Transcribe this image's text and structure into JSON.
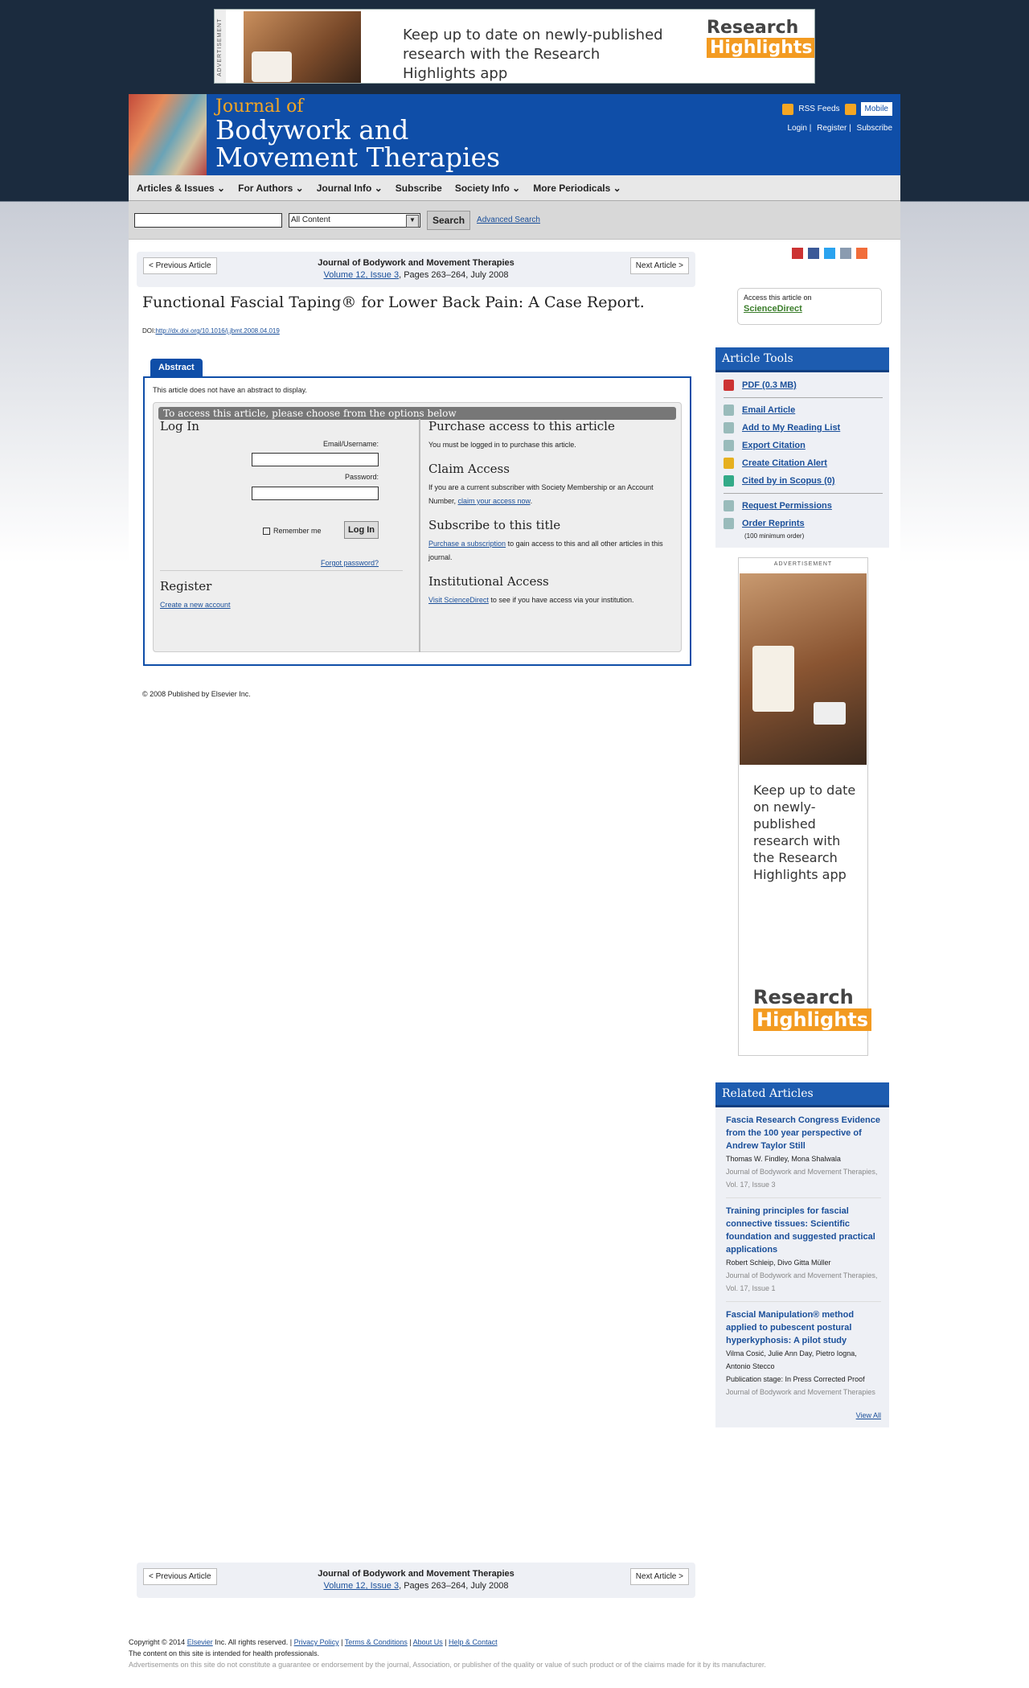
{
  "ad_top": {
    "label": "ADVERTISEMENT",
    "text": "Keep up to date on newly-published research with the Research Highlights app",
    "logo_top": "Research",
    "logo_bottom": "Highlights"
  },
  "header": {
    "journal_of": "Journal of",
    "journal_name_1": "Bodywork and",
    "journal_name_2": "Movement Therapies",
    "rss": "RSS Feeds",
    "mobile": "Mobile",
    "login": "Login",
    "register": "Register",
    "subscribe": "Subscribe"
  },
  "nav": [
    "Articles & Issues ⌄",
    "For Authors ⌄",
    "Journal Info ⌄",
    "Subscribe",
    "Society Info ⌄",
    "More Periodicals ⌄"
  ],
  "search": {
    "select": "All Content",
    "button": "Search",
    "advanced": "Advanced Search"
  },
  "artnav": {
    "prev": "< Previous Article",
    "next": "Next Article >",
    "journal": "Journal of Bodywork and Movement Therapies",
    "volume": "Volume 12, Issue 3",
    "pages": ", Pages 263–264, July 2008"
  },
  "article": {
    "title": "Functional Fascial Taping® for Lower Back Pain: A Case Report.",
    "doi_label": "DOI:",
    "doi": "http://dx.doi.org/10.1016/j.jbmt.2008.04.019",
    "tab": "Abstract",
    "no_abstract": "This article does not have an abstract to display.",
    "copyright": "© 2008 Published by Elsevier Inc."
  },
  "sciencedirect": {
    "line1": "Access this article on",
    "line2": "ScienceDirect"
  },
  "access": {
    "heading": "To access this article, please choose from the options below",
    "login": {
      "title": "Log In",
      "email": "Email/Username:",
      "password": "Password:",
      "remember": "Remember me",
      "button": "Log In",
      "forgot": "Forgot password?"
    },
    "register": {
      "title": "Register",
      "link": "Create a new account"
    },
    "purchase": {
      "title": "Purchase access to this article",
      "text": "You must be logged in to purchase this article."
    },
    "claim": {
      "title": "Claim Access",
      "text": "If you are a current subscriber with Society Membership or an Account Number, ",
      "link": "claim your access now",
      "end": "."
    },
    "subscribe": {
      "title": "Subscribe to this title",
      "link": "Purchase a subscription",
      "text": " to gain access to this and all other articles in this journal."
    },
    "institutional": {
      "title": "Institutional Access",
      "link": "Visit ScienceDirect",
      "text": " to see if you have access via your institution."
    }
  },
  "tools": {
    "title": "Article Tools",
    "items": [
      "PDF (0.3 MB)",
      "Email Article",
      "Add to My Reading List",
      "Export Citation",
      "Create Citation Alert",
      "Cited by in Scopus (0)",
      "Request Permissions",
      "Order Reprints"
    ],
    "reprint_note": "(100 minimum order)"
  },
  "ad_side": {
    "label": "ADVERTISEMENT",
    "text": "Keep up to date on newly-published research with the Research Highlights app",
    "logo_top": "Research",
    "logo_bottom": "Highlights"
  },
  "related": {
    "title": "Related Articles",
    "items": [
      {
        "title": "Fascia Research Congress Evidence from the 100 year perspective of Andrew Taylor Still",
        "authors": "Thomas W. Findley, Mona Shalwala",
        "journal": "Journal of Bodywork and Movement Therapies, Vol. 17, Issue 3"
      },
      {
        "title": "Training principles for fascial connective tissues: Scientific foundation and suggested practical applications",
        "authors": "Robert Schleip, Divo Gitta Müller",
        "journal": "Journal of Bodywork and Movement Therapies, Vol. 17, Issue 1"
      },
      {
        "title": "Fascial Manipulation® method applied to pubescent postural hyperkyphosis: A pilot study",
        "authors": "Vilma Cosić, Julie Ann Day, Pietro Iogna, Antonio Stecco",
        "status": "Publication stage: In Press Corrected Proof",
        "journal": "Journal of Bodywork and Movement Therapies"
      }
    ],
    "view_all": "View All"
  },
  "footer": {
    "copyright": "Copyright © 2014 ",
    "elsevier": "Elsevier",
    "rest": " Inc. All rights reserved. | ",
    "privacy": "Privacy Policy",
    "terms": "Terms & Conditions",
    "about": "About Us",
    "help": "Help & Contact",
    "hp": "The content on this site is intended for health professionals.",
    "disclaimer": "Advertisements on this site do not constitute a guarantee or endorsement by the journal, Association, or publisher of the quality or value of such product or of the claims made for it by its manufacturer."
  }
}
